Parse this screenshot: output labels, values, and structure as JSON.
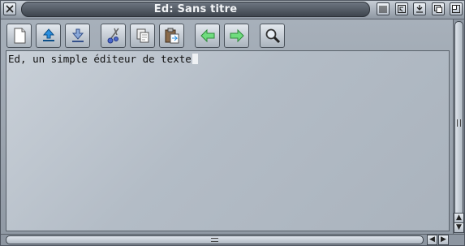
{
  "window": {
    "title": "Ed: Sans titre"
  },
  "titlebar_buttons": {
    "close": "close-icon",
    "iconify": "iconify-icon",
    "jump": "jump-icon",
    "snapshot": "snapshot-icon",
    "depth": "depth-icon",
    "zoom": "zoom-icon"
  },
  "toolbar": {
    "items": [
      "new-document-icon",
      "open-file-icon",
      "save-file-icon",
      "cut-icon",
      "copy-icon",
      "paste-icon",
      "undo-arrow-icon",
      "redo-arrow-icon",
      "search-icon"
    ]
  },
  "editor": {
    "text": "Ed, un simple éditeur de texte"
  },
  "colors": {
    "titlebar_cap": "#4f5660",
    "arrow_green": "#3fbf5a",
    "upload_blue": "#2a8fe0"
  }
}
